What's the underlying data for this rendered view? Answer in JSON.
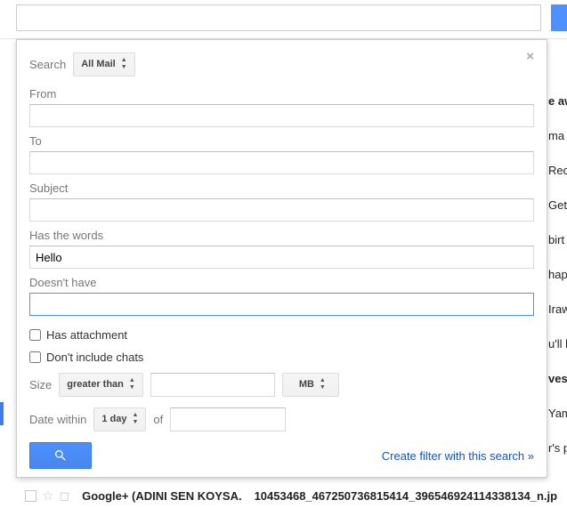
{
  "topbar": {
    "value": ""
  },
  "panel": {
    "close": "×",
    "search_label": "Search",
    "scope": "All Mail",
    "from_label": "From",
    "from_value": "",
    "to_label": "To",
    "to_value": "",
    "subject_label": "Subject",
    "subject_value": "",
    "haswords_label": "Has the words",
    "haswords_value": "Hello",
    "nothave_label": "Doesn't have",
    "nothave_value": "",
    "has_attachment_label": "Has attachment",
    "no_chats_label": "Don't include chats",
    "size_label": "Size",
    "size_op": "greater than",
    "size_value": "",
    "size_unit": "MB",
    "date_label": "Date within",
    "date_range": "1 day",
    "date_of": "of",
    "date_value": "",
    "filter_link": "Create filter with this search »"
  },
  "bg": {
    "r0": "e aw",
    "r1": "ma /",
    "r2": "Rec",
    "r3": "Get",
    "r4": "birt",
    "r5": "hap",
    "r6": "Iraw",
    "r7": "u'll l",
    "r8": "ves",
    "r9": "Yam",
    "r10": "r's p"
  },
  "mail": {
    "sender": "Google+ (ADINI SEN KOYSA.",
    "subject": "10453468_467250736815414_396546924114338134_n.jp"
  }
}
